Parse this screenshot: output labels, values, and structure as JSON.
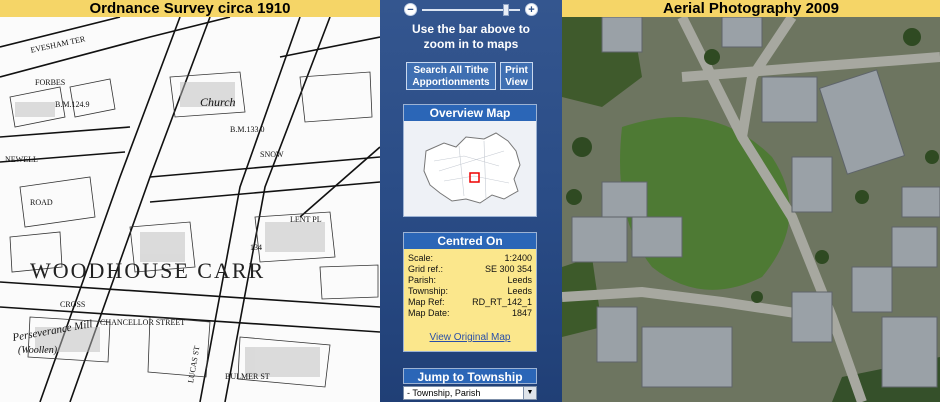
{
  "left_panel": {
    "title": "Ordnance Survey circa 1910",
    "labels": [
      "EVESHAM TER",
      "B.M.124.9",
      "Church",
      "B.M.133.0",
      "WOODHOUSE CARR",
      "Perseverance Mill",
      "(Woollen)",
      "CHANCELLOR STREET",
      "BULMER ST",
      "LUCAS ST",
      "CROSS",
      "LENT PL",
      "134",
      "NEWELL",
      "ROAD",
      "FORBES",
      "SNOW"
    ]
  },
  "right_panel": {
    "title": "Aerial Photography 2009"
  },
  "center": {
    "zoom_minus": "−",
    "zoom_plus": "+",
    "zoom_level": 0.88,
    "hint": "Use the bar above to zoom in to maps",
    "search_button": [
      "Search All Tithe",
      "Apportionments"
    ],
    "print_button": [
      "Print",
      "View"
    ],
    "overview_title": "Overview Map",
    "centred_title": "Centred On",
    "info": [
      {
        "label": "Scale:",
        "value": "1:2400"
      },
      {
        "label": "Grid ref.:",
        "value": "SE 300 354"
      },
      {
        "label": "Parish:",
        "value": "Leeds"
      },
      {
        "label": "Township:",
        "value": "Leeds"
      },
      {
        "label": "Map Ref:",
        "value": "RD_RT_142_1"
      },
      {
        "label": "Map Date:",
        "value": "1847"
      }
    ],
    "view_link": "View Original Map",
    "jump_title": "Jump to Township",
    "select_value": "- Township, Parish",
    "caret": "▼"
  },
  "colors": {
    "title_bar": "#f5d567",
    "panel_blue": "#2b4f88",
    "box_blue": "#2b66b7",
    "info_bg": "#fbe78c"
  }
}
